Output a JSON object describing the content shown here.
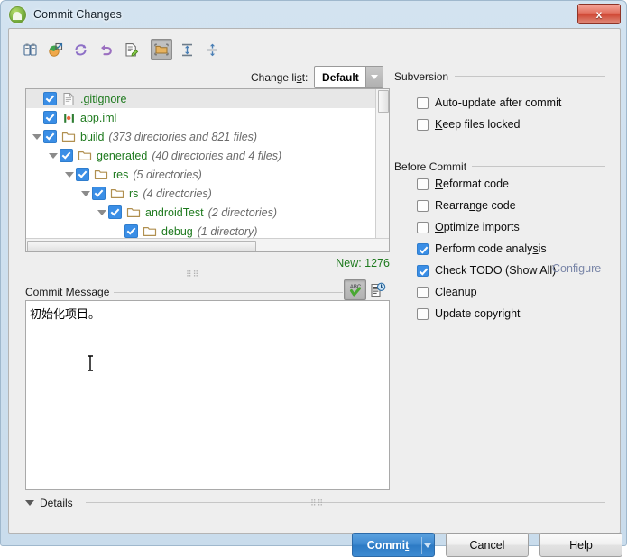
{
  "window": {
    "title": "Commit Changes",
    "app_icon": "android-studio-icon",
    "close_label": "x"
  },
  "toolbar": {
    "buttons": [
      {
        "name": "show-diff-icon",
        "tooltip": "Show Diff",
        "pressed": false
      },
      {
        "name": "move-to-another-changelist-icon",
        "tooltip": "Move to Another Changelist",
        "pressed": false
      },
      {
        "name": "refresh-icon",
        "tooltip": "Refresh",
        "pressed": false
      },
      {
        "name": "revert-icon",
        "tooltip": "Revert",
        "pressed": false
      },
      {
        "name": "edit-source-icon",
        "tooltip": "Edit Source",
        "pressed": false
      },
      {
        "name": "group-by-directory-icon",
        "tooltip": "Group by Directory",
        "pressed": true
      },
      {
        "name": "expand-all-icon",
        "tooltip": "Expand All",
        "pressed": false
      },
      {
        "name": "collapse-all-icon",
        "tooltip": "Collapse All",
        "pressed": false
      }
    ],
    "changelist_label_pre": "Change li",
    "changelist_label_mnemonic": "s",
    "changelist_label_post": "t:",
    "changelist_value": "Default"
  },
  "tree": {
    "rows": [
      {
        "indent": 0,
        "arrow": false,
        "checked": true,
        "icon": "file-icon",
        "name": ".gitignore",
        "meta": "",
        "selected": true
      },
      {
        "indent": 0,
        "arrow": false,
        "checked": true,
        "icon": "iml-icon",
        "name": "app.iml",
        "meta": "",
        "selected": false
      },
      {
        "indent": 0,
        "arrow": true,
        "checked": true,
        "icon": "folder-icon",
        "name": "build",
        "meta": "(373 directories and 821 files)",
        "selected": false
      },
      {
        "indent": 1,
        "arrow": true,
        "checked": true,
        "icon": "folder-icon",
        "name": "generated",
        "meta": "(40 directories and 4 files)",
        "selected": false
      },
      {
        "indent": 2,
        "arrow": true,
        "checked": true,
        "icon": "folder-icon",
        "name": "res",
        "meta": "(5 directories)",
        "selected": false
      },
      {
        "indent": 3,
        "arrow": true,
        "checked": true,
        "icon": "folder-icon",
        "name": "rs",
        "meta": "(4 directories)",
        "selected": false
      },
      {
        "indent": 4,
        "arrow": true,
        "checked": true,
        "icon": "folder-icon",
        "name": "androidTest",
        "meta": "(2 directories)",
        "selected": false
      },
      {
        "indent": 5,
        "arrow": false,
        "checked": true,
        "icon": "folder-icon",
        "name": "debug",
        "meta": "(1 directory)",
        "selected": false
      }
    ],
    "new_count": "New: 1276"
  },
  "commit_message": {
    "label_mnemonic": "C",
    "label_rest": "ommit Message",
    "value": "初始化项目。",
    "spellcheck_icon": "spellcheck-abc-icon",
    "history_icon": "message-history-icon"
  },
  "subversion": {
    "title": "Subversion",
    "options": [
      {
        "label_pre": "",
        "mnemonic": "",
        "label_post": "Auto-update after commit",
        "checked": false,
        "name": "auto-update-after-commit"
      },
      {
        "label_pre": "",
        "mnemonic": "K",
        "label_post": "eep files locked",
        "checked": false,
        "name": "keep-files-locked"
      }
    ]
  },
  "before_commit": {
    "title": "Before Commit",
    "options": [
      {
        "label_pre": "",
        "mnemonic": "R",
        "label_post": "eformat code",
        "checked": false,
        "name": "reformat-code"
      },
      {
        "label_pre": "Rearra",
        "mnemonic": "n",
        "label_post": "ge code",
        "checked": false,
        "name": "rearrange-code"
      },
      {
        "label_pre": "",
        "mnemonic": "O",
        "label_post": "ptimize imports",
        "checked": false,
        "name": "optimize-imports"
      },
      {
        "label_pre": "Perform code analy",
        "mnemonic": "s",
        "label_post": "is",
        "checked": true,
        "name": "perform-code-analysis"
      },
      {
        "label_pre": "Check TODO (Show All)",
        "mnemonic": "",
        "label_post": "",
        "checked": true,
        "name": "check-todo"
      },
      {
        "label_pre": "C",
        "mnemonic": "l",
        "label_post": "eanup",
        "checked": false,
        "name": "cleanup"
      },
      {
        "label_pre": "Update copyright",
        "mnemonic": "",
        "label_post": "",
        "checked": false,
        "name": "update-copyright"
      }
    ],
    "configure_link": "Configure"
  },
  "details": {
    "label": "Details",
    "expanded": false
  },
  "buttons": {
    "commit_pre": "Commi",
    "commit_mnemonic": "t",
    "cancel": "Cancel",
    "help": "Help"
  }
}
